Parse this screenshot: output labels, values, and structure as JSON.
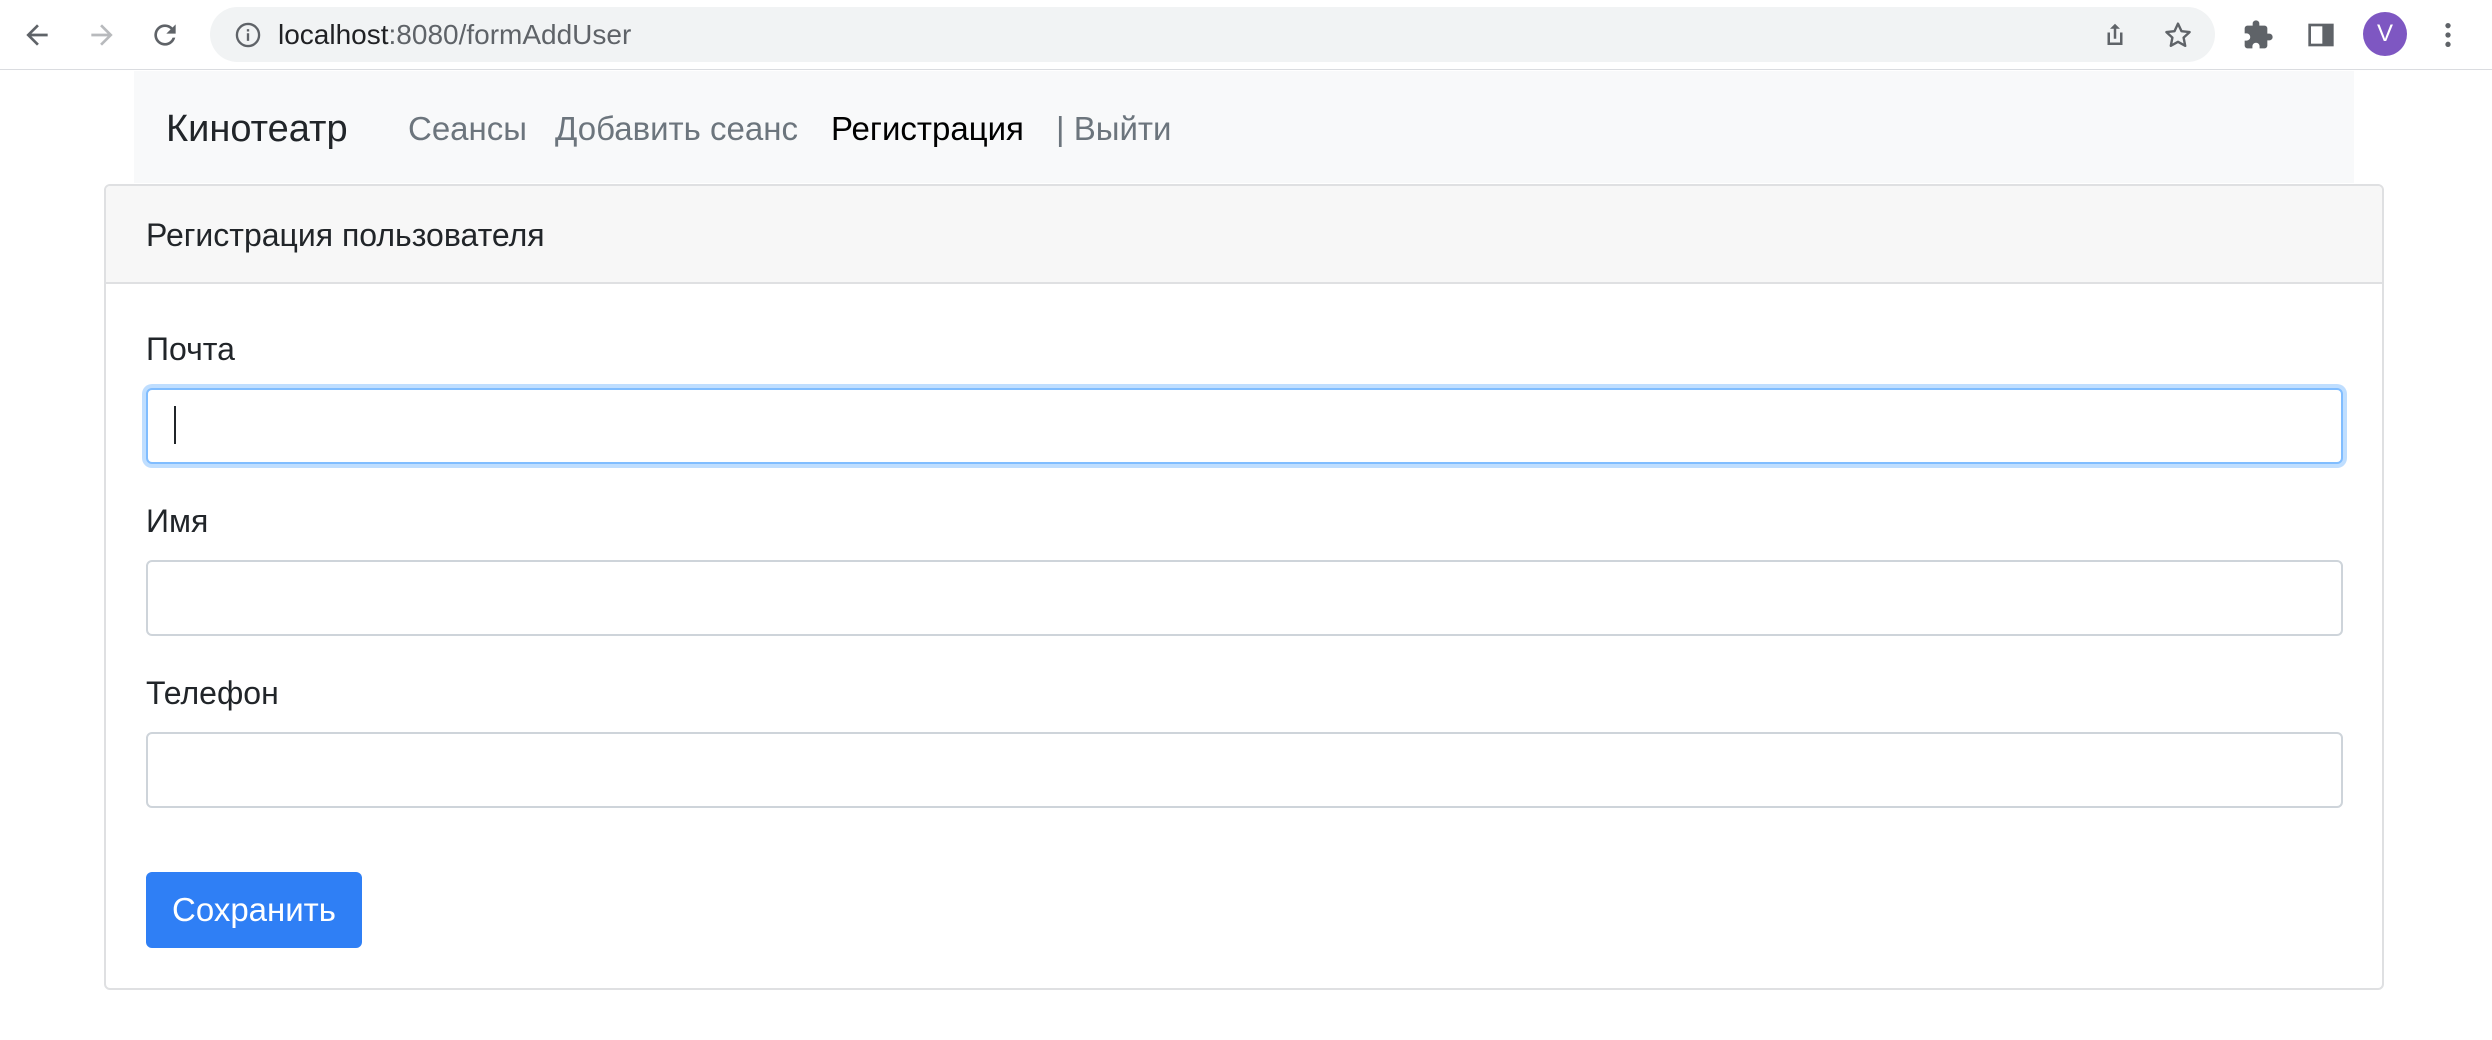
{
  "browser": {
    "url_host": "localhost",
    "url_path": ":8080/formAddUser",
    "profile_initial": "V",
    "accent_color": "#7e57c2"
  },
  "icons": {
    "back": "back-arrow-icon",
    "forward": "forward-arrow-icon",
    "reload": "reload-icon",
    "site_info": "info-icon",
    "share": "share-icon",
    "bookmark": "star-icon",
    "extensions": "puzzle-icon",
    "side_panel": "side-panel-icon",
    "menu": "kebab-menu-icon"
  },
  "navbar": {
    "brand": "Кинотеатр",
    "links": [
      {
        "label": "Сеансы",
        "active": false
      },
      {
        "label": "Добавить сеанс",
        "active": false
      },
      {
        "label": "Регистрация",
        "active": true
      },
      {
        "label": "| Выйти",
        "active": false
      }
    ]
  },
  "form": {
    "title": "Регистрация пользователя",
    "fields": [
      {
        "label": "Почта",
        "value": "",
        "focused": true
      },
      {
        "label": "Имя",
        "value": "",
        "focused": false
      },
      {
        "label": "Телефон",
        "value": "",
        "focused": false
      }
    ],
    "submit_label": "Сохранить",
    "submit_color": "#2f7ff5"
  }
}
